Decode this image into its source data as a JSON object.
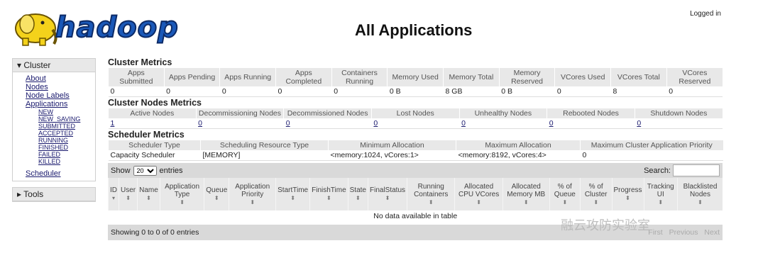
{
  "header": {
    "logo_text": "hadoop",
    "title": "All Applications",
    "logged_in": "Logged in"
  },
  "nav": {
    "cluster_label": "Cluster",
    "links": [
      "About",
      "Nodes",
      "Node Labels",
      "Applications"
    ],
    "app_states": [
      "NEW",
      "NEW_SAVING",
      "SUBMITTED",
      "ACCEPTED",
      "RUNNING",
      "FINISHED",
      "FAILED",
      "KILLED"
    ],
    "scheduler": "Scheduler",
    "tools_label": "Tools"
  },
  "cluster_metrics": {
    "title": "Cluster Metrics",
    "headers": [
      "Apps Submitted",
      "Apps Pending",
      "Apps Running",
      "Apps Completed",
      "Containers Running",
      "Memory Used",
      "Memory Total",
      "Memory Reserved",
      "VCores Used",
      "VCores Total",
      "VCores Reserved"
    ],
    "values": [
      "0",
      "0",
      "0",
      "0",
      "0",
      "0 B",
      "8 GB",
      "0 B",
      "0",
      "8",
      "0"
    ]
  },
  "cluster_nodes_metrics": {
    "title": "Cluster Nodes Metrics",
    "headers": [
      "Active Nodes",
      "Decommissioning Nodes",
      "Decommissioned Nodes",
      "Lost Nodes",
      "Unhealthy Nodes",
      "Rebooted Nodes",
      "Shutdown Nodes"
    ],
    "values": [
      "1",
      "0",
      "0",
      "0",
      "0",
      "0",
      "0"
    ]
  },
  "scheduler_metrics": {
    "title": "Scheduler Metrics",
    "headers": [
      "Scheduler Type",
      "Scheduling Resource Type",
      "Minimum Allocation",
      "Maximum Allocation",
      "Maximum Cluster Application Priority"
    ],
    "values": [
      "Capacity Scheduler",
      "[MEMORY]",
      "<memory:1024, vCores:1>",
      "<memory:8192, vCores:4>",
      "0"
    ]
  },
  "apps_table": {
    "show_label": "Show",
    "entries_value": "20",
    "entries_label": "entries",
    "search_label": "Search:",
    "columns": [
      "ID",
      "User",
      "Name",
      "Application Type",
      "Queue",
      "Application Priority",
      "StartTime",
      "FinishTime",
      "State",
      "FinalStatus",
      "Running Containers",
      "Allocated CPU VCores",
      "Allocated Memory MB",
      "% of Queue",
      "% of Cluster",
      "Progress",
      "Tracking UI",
      "Blacklisted Nodes"
    ],
    "empty_message": "No data available in table",
    "showing": "Showing 0 to 0 of 0 entries",
    "pager": [
      "First",
      "Previous",
      "Next"
    ]
  },
  "watermark": "融云攻防实验室"
}
